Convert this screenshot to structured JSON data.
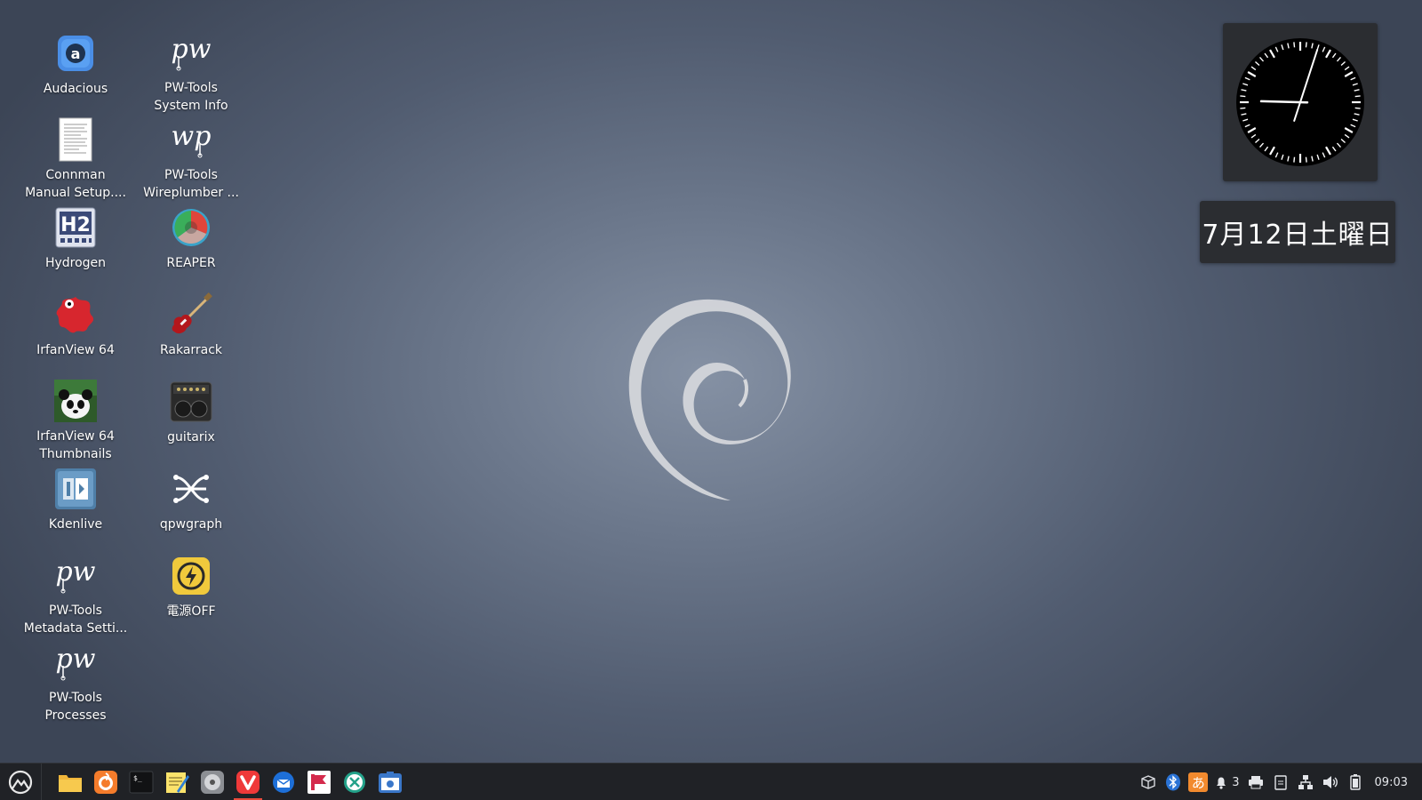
{
  "desktop": {
    "icons": [
      {
        "label_1": "Audacious",
        "label_2": "",
        "icon": "audacious-icon"
      },
      {
        "label_1": "PW-Tools",
        "label_2": "System Info",
        "icon": "pw-tools-icon"
      },
      {
        "label_1": "Connman",
        "label_2": "Manual Setup....",
        "icon": "document-icon"
      },
      {
        "label_1": "PW-Tools",
        "label_2": "Wireplumber ...",
        "icon": "wp-tools-icon"
      },
      {
        "label_1": "Hydrogen",
        "label_2": "",
        "icon": "hydrogen-icon"
      },
      {
        "label_1": "REAPER",
        "label_2": "",
        "icon": "reaper-icon"
      },
      {
        "label_1": "IrfanView 64",
        "label_2": "",
        "icon": "irfanview-icon"
      },
      {
        "label_1": "Rakarrack",
        "label_2": "",
        "icon": "guitar-icon"
      },
      {
        "label_1": "IrfanView 64",
        "label_2": "Thumbnails",
        "icon": "panda-icon"
      },
      {
        "label_1": "guitarix",
        "label_2": "",
        "icon": "amplifier-icon"
      },
      {
        "label_1": "Kdenlive",
        "label_2": "",
        "icon": "kdenlive-icon"
      },
      {
        "label_1": "qpwgraph",
        "label_2": "",
        "icon": "qpwgraph-icon"
      },
      {
        "label_1": "PW-Tools",
        "label_2": "Metadata Setti...",
        "icon": "pw-tools-icon"
      },
      {
        "label_1": "電源OFF",
        "label_2": "",
        "icon": "power-icon"
      },
      {
        "label_1": "PW-Tools",
        "label_2": "Processes",
        "icon": "pw-tools-icon"
      }
    ]
  },
  "widgets": {
    "clock": {
      "time": "09:03",
      "face_color": "#000000"
    },
    "date": {
      "text": "7月12日土曜日"
    }
  },
  "taskbar": {
    "launchers": [
      {
        "icon": "file-manager-icon",
        "active": false
      },
      {
        "icon": "firefox-icon",
        "active": false
      },
      {
        "icon": "terminal-icon",
        "active": false
      },
      {
        "icon": "text-editor-icon",
        "active": false
      },
      {
        "icon": "disk-utility-icon",
        "active": false
      },
      {
        "icon": "vivaldi-icon",
        "active": true
      },
      {
        "icon": "thunderbird-icon",
        "active": false
      },
      {
        "icon": "flathub-icon",
        "active": false
      },
      {
        "icon": "xcode-tool-icon",
        "active": false
      },
      {
        "icon": "screenshot-icon",
        "active": false
      }
    ],
    "tray": {
      "input_method_label": "あ",
      "notification_count": "3",
      "clock": "09:03"
    },
    "colors": {
      "active_indicator": "#e94b3c",
      "background": "#202226"
    }
  }
}
